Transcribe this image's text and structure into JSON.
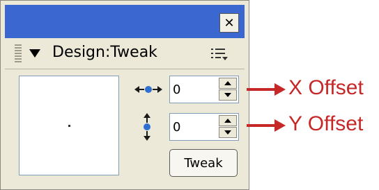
{
  "panel": {
    "title": "Design:Tweak",
    "close_glyph": "✕",
    "icons": {
      "close": "close-icon",
      "gripper": "gripper-icon",
      "collapse": "collapse-triangle-icon",
      "options": "options-menu-icon",
      "x_offset": "horizontal-offset-icon",
      "y_offset": "vertical-offset-icon"
    }
  },
  "x_offset": {
    "value": "0"
  },
  "y_offset": {
    "value": "0"
  },
  "buttons": {
    "tweak": "Tweak"
  },
  "annotations": {
    "x_label": "X Offset",
    "y_label": "Y Offset",
    "color": "#c62828"
  },
  "colors": {
    "titlebar": "#3a67d0",
    "panel_bg": "#ece9d8"
  }
}
